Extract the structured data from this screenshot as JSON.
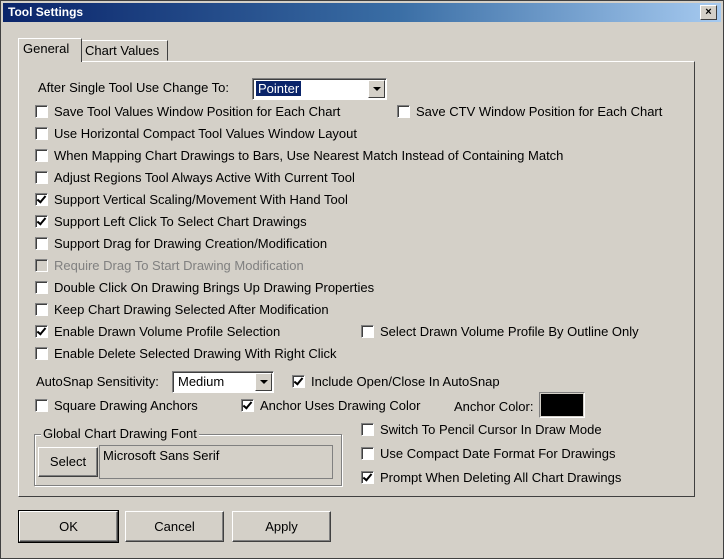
{
  "window": {
    "title": "Tool Settings",
    "close_glyph": "×"
  },
  "tabs": [
    {
      "label": "General"
    },
    {
      "label": "Chart Values"
    }
  ],
  "after_single_tool": {
    "label": "After Single Tool Use Change To:",
    "value": "Pointer"
  },
  "options": [
    {
      "label": "Save Tool Values Window Position for Each Chart",
      "checked": false,
      "enabled": true
    },
    {
      "label": "Save CTV Window Position for Each Chart",
      "checked": false,
      "enabled": true
    },
    {
      "label": "Use Horizontal Compact Tool Values Window Layout",
      "checked": false,
      "enabled": true
    },
    {
      "label": "When Mapping Chart Drawings to Bars, Use Nearest Match Instead of Containing Match",
      "checked": false,
      "enabled": true
    },
    {
      "label": "Adjust Regions Tool Always Active With Current Tool",
      "checked": false,
      "enabled": true
    },
    {
      "label": "Support Vertical Scaling/Movement With Hand Tool",
      "checked": true,
      "enabled": true
    },
    {
      "label": "Support Left Click To Select Chart Drawings",
      "checked": true,
      "enabled": true
    },
    {
      "label": "Support Drag for Drawing Creation/Modification",
      "checked": false,
      "enabled": true
    },
    {
      "label": "Require Drag To Start Drawing Modification",
      "checked": false,
      "enabled": false
    },
    {
      "label": "Double Click On Drawing Brings Up Drawing Properties",
      "checked": false,
      "enabled": true
    },
    {
      "label": "Keep Chart Drawing Selected After Modification",
      "checked": false,
      "enabled": true
    },
    {
      "label": "Enable Drawn Volume Profile Selection",
      "checked": true,
      "enabled": true
    },
    {
      "label": "Select Drawn Volume Profile By Outline Only",
      "checked": false,
      "enabled": true
    },
    {
      "label": "Enable Delete Selected Drawing With Right Click",
      "checked": false,
      "enabled": true
    }
  ],
  "autosnap": {
    "label": "AutoSnap Sensitivity:",
    "value": "Medium"
  },
  "include_open_close": {
    "label": "Include Open/Close In AutoSnap",
    "checked": true
  },
  "square_anchors": {
    "label": "Square Drawing Anchors",
    "checked": false
  },
  "anchor_uses_color": {
    "label": "Anchor Uses Drawing Color",
    "checked": true
  },
  "anchor_color": {
    "label": "Anchor Color:",
    "color": "#000000"
  },
  "font_group": {
    "legend": "Global Chart Drawing Font",
    "select_label": "Select",
    "font_name": "Microsoft Sans Serif"
  },
  "pencil_cursor": {
    "label": "Switch To Pencil Cursor In Draw Mode",
    "checked": false
  },
  "compact_date": {
    "label": "Use Compact Date Format For Drawings",
    "checked": false
  },
  "prompt_delete": {
    "label": "Prompt When Deleting All Chart Drawings",
    "checked": true
  },
  "buttons": {
    "ok": "OK",
    "cancel": "Cancel",
    "apply": "Apply"
  }
}
